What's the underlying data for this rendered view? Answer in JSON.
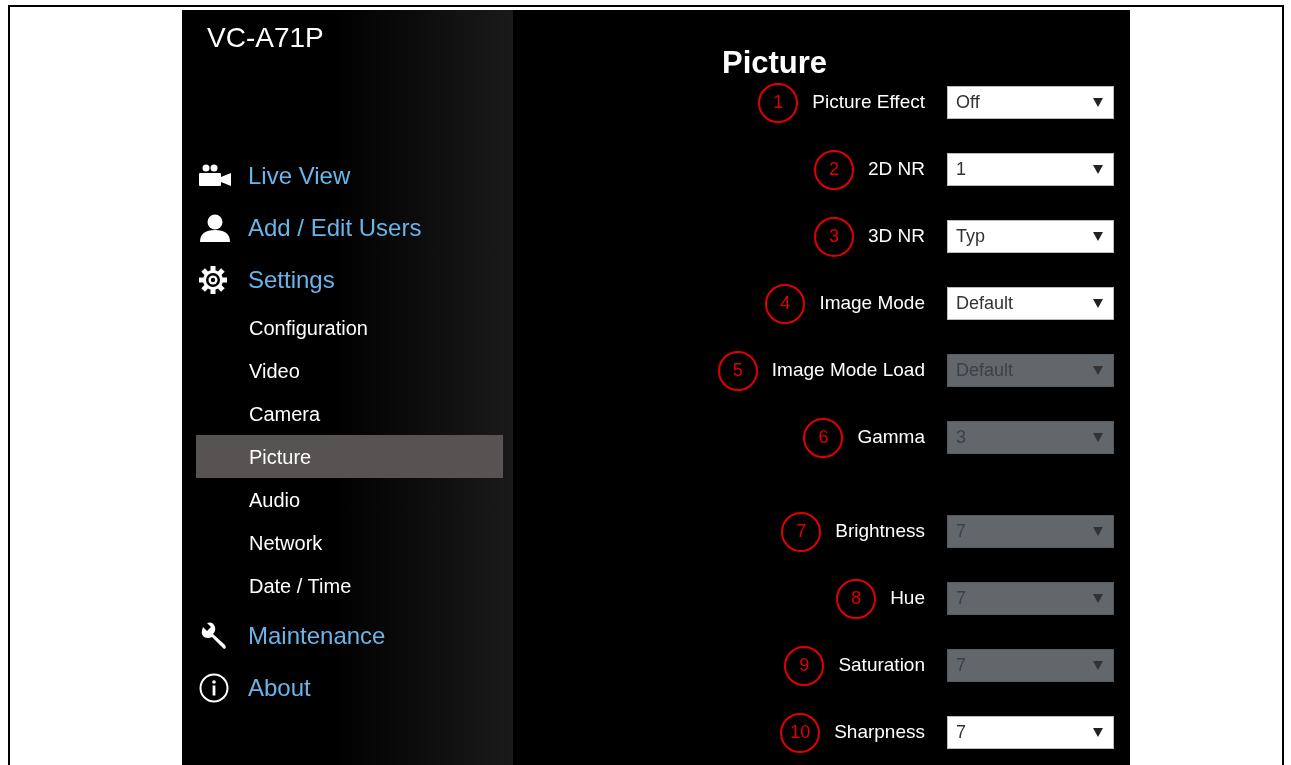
{
  "sidebar": {
    "title": "VC-A71P",
    "items": [
      {
        "label": "Live View",
        "kind": "main",
        "selected": false
      },
      {
        "label": "Add / Edit Users",
        "kind": "main",
        "selected": false
      },
      {
        "label": "Settings",
        "kind": "main",
        "selected": false
      },
      {
        "label": "Configuration",
        "kind": "sub",
        "selected": false
      },
      {
        "label": "Video",
        "kind": "sub",
        "selected": false
      },
      {
        "label": "Camera",
        "kind": "sub",
        "selected": false
      },
      {
        "label": "Picture",
        "kind": "sub",
        "selected": true
      },
      {
        "label": "Audio",
        "kind": "sub",
        "selected": false
      },
      {
        "label": "Network",
        "kind": "sub",
        "selected": false
      },
      {
        "label": "Date / Time",
        "kind": "sub",
        "selected": false
      },
      {
        "label": "Maintenance",
        "kind": "main",
        "selected": false
      },
      {
        "label": "About",
        "kind": "main",
        "selected": false
      }
    ]
  },
  "content": {
    "heading": "Picture",
    "settings": [
      {
        "callout": "1",
        "label": "Picture Effect",
        "value": "Off",
        "disabled": false
      },
      {
        "callout": "2",
        "label": "2D NR",
        "value": "1",
        "disabled": false
      },
      {
        "callout": "3",
        "label": "3D NR",
        "value": "Typ",
        "disabled": false
      },
      {
        "callout": "4",
        "label": "Image Mode",
        "value": "Default",
        "disabled": false
      },
      {
        "callout": "5",
        "label": "Image Mode Load",
        "value": "Default",
        "disabled": true
      },
      {
        "callout": "6",
        "label": "Gamma",
        "value": "3",
        "disabled": true
      },
      {
        "callout": "7",
        "label": "Brightness",
        "value": "7",
        "disabled": true
      },
      {
        "callout": "8",
        "label": "Hue",
        "value": "7",
        "disabled": true
      },
      {
        "callout": "9",
        "label": "Saturation",
        "value": "7",
        "disabled": true
      },
      {
        "callout": "10",
        "label": "Sharpness",
        "value": "7",
        "disabled": false
      }
    ]
  }
}
